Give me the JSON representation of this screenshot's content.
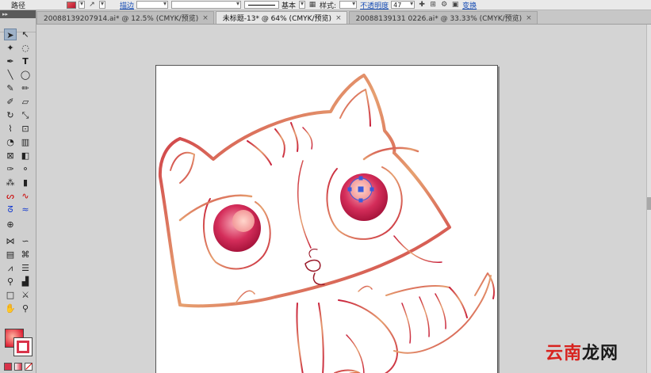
{
  "option_bar": {
    "path_label": "路径",
    "brush_label": "描边",
    "stroke_style_label": "基本",
    "style_label": "样式:",
    "opacity_link": "不透明度",
    "opacity_value": "47",
    "transform_link": "变换",
    "fill_color": "#d9334a"
  },
  "tabs": [
    {
      "label": "20088139207914.ai* @ 12.5% (CMYK/预览)",
      "active": false,
      "close": "×"
    },
    {
      "label": "未标题-13* @ 64% (CMYK/预览)",
      "active": true,
      "close": "×"
    },
    {
      "label": "20088139131 0226.ai* @ 33.33% (CMYK/预览)",
      "active": false,
      "close": "×"
    }
  ],
  "toolbox": {
    "header": "▸▸"
  },
  "colors": {
    "stroke_red": "#c81e3a",
    "stroke_orange": "#d98a55",
    "eye_pink": "#d42d5a",
    "selection_blue": "#3b5bdb"
  },
  "watermark": {
    "text_red": "云南",
    "text_black": "龙网"
  }
}
